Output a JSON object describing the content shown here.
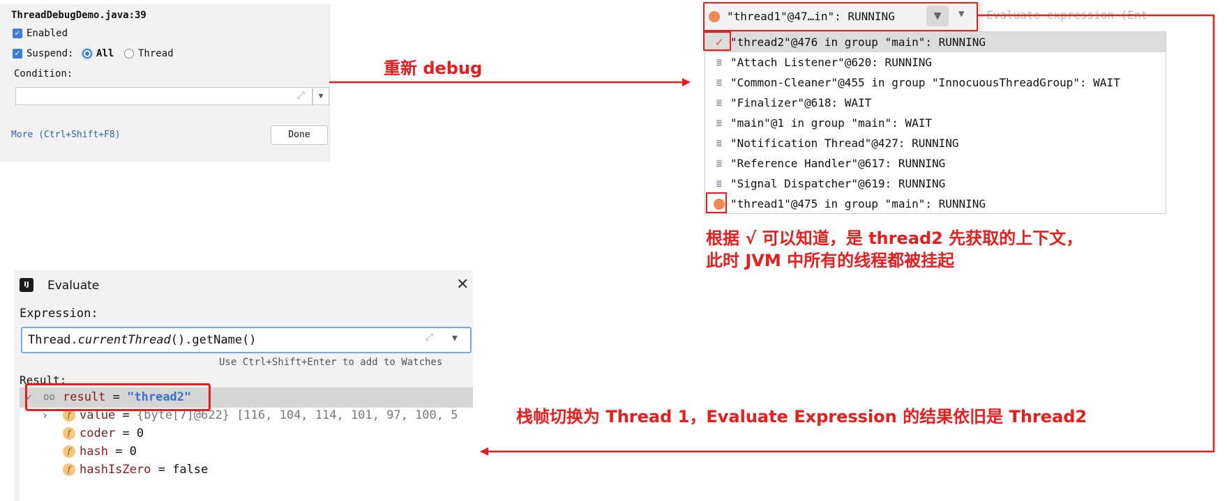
{
  "breakpoint": {
    "title": "ThreadDebugDemo.java:39",
    "enabled_label": "Enabled",
    "suspend_label": "Suspend:",
    "suspend_all": "All",
    "suspend_thread": "Thread",
    "condition_label": "Condition:",
    "more_link": "More (Ctrl+Shift+F8)",
    "done": "Done"
  },
  "thread_selector": {
    "current": "\"thread1\"@47…in\": RUNNING",
    "eval_placeholder": "Evaluate expression (Ent",
    "threads": [
      {
        "label": "\"thread2\"@476 in group \"main\": RUNNING",
        "icon": "checkmark-icon",
        "selected": true
      },
      {
        "label": "\"Attach Listener\"@620: RUNNING",
        "icon": "thread-icon"
      },
      {
        "label": "\"Common-Cleaner\"@455 in group \"InnocuousThreadGroup\": WAIT",
        "icon": "thread-icon"
      },
      {
        "label": "\"Finalizer\"@618: WAIT",
        "icon": "thread-icon"
      },
      {
        "label": "\"main\"@1 in group \"main\": WAIT",
        "icon": "thread-icon"
      },
      {
        "label": "\"Notification Thread\"@427: RUNNING",
        "icon": "thread-icon"
      },
      {
        "label": "\"Reference Handler\"@617: RUNNING",
        "icon": "thread-icon"
      },
      {
        "label": "\"Signal Dispatcher\"@619: RUNNING",
        "icon": "thread-icon"
      },
      {
        "label": "\"thread1\"@475 in group \"main\": RUNNING",
        "icon": "breakpoint-dot-icon"
      }
    ]
  },
  "annotations": {
    "rerun": "重新 debug",
    "note_line1": "根据 √ 可以知道，是 thread2 先获取的上下文，",
    "note_line2": "此时 JVM 中所有的线程都被挂起",
    "bottom_note": "栈帧切换为 Thread 1，Evaluate Expression 的结果依旧是 Thread2"
  },
  "evaluate": {
    "title": "Evaluate",
    "expression_label": "Expression:",
    "expression": {
      "prefix": "Thread.",
      "italic": "currentThread",
      "suffix": "().getName()"
    },
    "hint": "Use Ctrl+Shift+Enter to add to Watches",
    "result_label": "Result:",
    "result": {
      "name": "result",
      "eq": " = ",
      "value": "\"thread2\""
    },
    "fields": [
      {
        "name": "value",
        "value": "{byte[7]@622} [116, 104, 114, 101, 97, 100, 5"
      },
      {
        "name": "coder",
        "value": "0"
      },
      {
        "name": "hash",
        "value": "0"
      },
      {
        "name": "hashIsZero",
        "value": "false"
      }
    ]
  },
  "colors": {
    "annotation_red": "#ea1c1c",
    "accent_blue": "#3d7dd6",
    "breakpoint_orange": "#ef8a55"
  }
}
